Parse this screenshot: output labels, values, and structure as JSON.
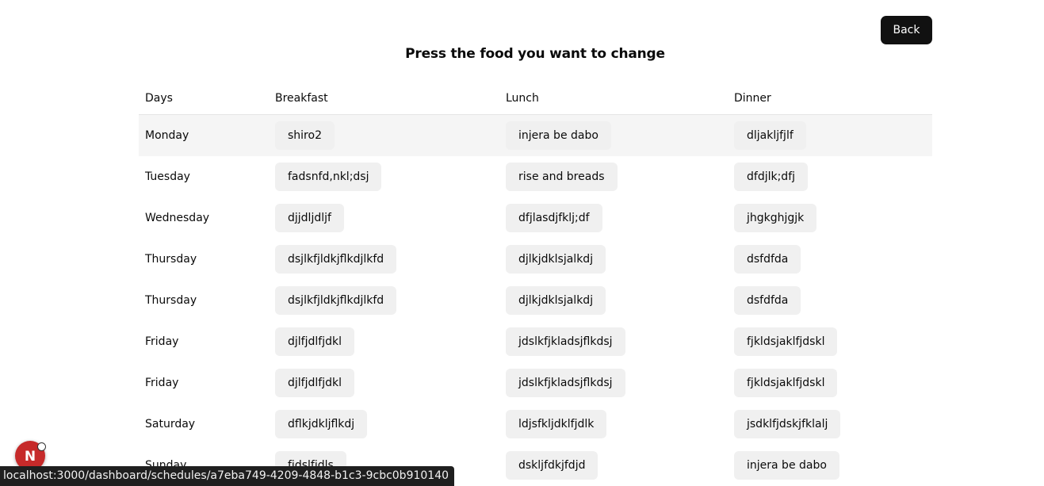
{
  "header": {
    "back_label": "Back",
    "title": "Press the food you want to change"
  },
  "table": {
    "columns": [
      "Days",
      "Breakfast",
      "Lunch",
      "Dinner"
    ],
    "rows": [
      {
        "day": "Monday",
        "breakfast": "shiro2",
        "lunch": "injera be dabo",
        "dinner": "dljakljfjlf"
      },
      {
        "day": "Tuesday",
        "breakfast": "fadsnfd,nkl;dsj",
        "lunch": "rise and breads",
        "dinner": "dfdjlk;dfj"
      },
      {
        "day": "Wednesday",
        "breakfast": "djjdljdljf",
        "lunch": "dfjlasdjfklj;df",
        "dinner": "jhgkghjgjk"
      },
      {
        "day": "Thursday",
        "breakfast": "dsjlkfjldkjflkdjlkfd",
        "lunch": "djlkjdklsjalkdj",
        "dinner": "dsfdfda"
      },
      {
        "day": "Thursday",
        "breakfast": "dsjlkfjldkjflkdjlkfd",
        "lunch": "djlkjdklsjalkdj",
        "dinner": "dsfdfda"
      },
      {
        "day": "Friday",
        "breakfast": "djlfjdlfjdkl",
        "lunch": "jdslkfjkladsjflkdsj",
        "dinner": "fjkldsjaklfjdskl"
      },
      {
        "day": "Friday",
        "breakfast": "djlfjdlfjdkl",
        "lunch": "jdslkfjkladsjflkdsj",
        "dinner": "fjkldsjaklfjdskl"
      },
      {
        "day": "Saturday",
        "breakfast": "dflkjdkljflkdj",
        "lunch": "ldjsfkljdklfjdlk",
        "dinner": "jsdklfjdskjfklalj"
      },
      {
        "day": "Sunday",
        "breakfast": "fjdslfjdls",
        "lunch": "dskljfdkjfdjd",
        "dinner": "injera be dabo"
      }
    ]
  },
  "status_bar": {
    "url": "localhost:3000/dashboard/schedules/a7eba749-4209-4848-b1c3-9cbc0b910140"
  },
  "dev_badge": {
    "letter": "N",
    "icon": "nextjs-icon",
    "color": "#c62a2a"
  }
}
